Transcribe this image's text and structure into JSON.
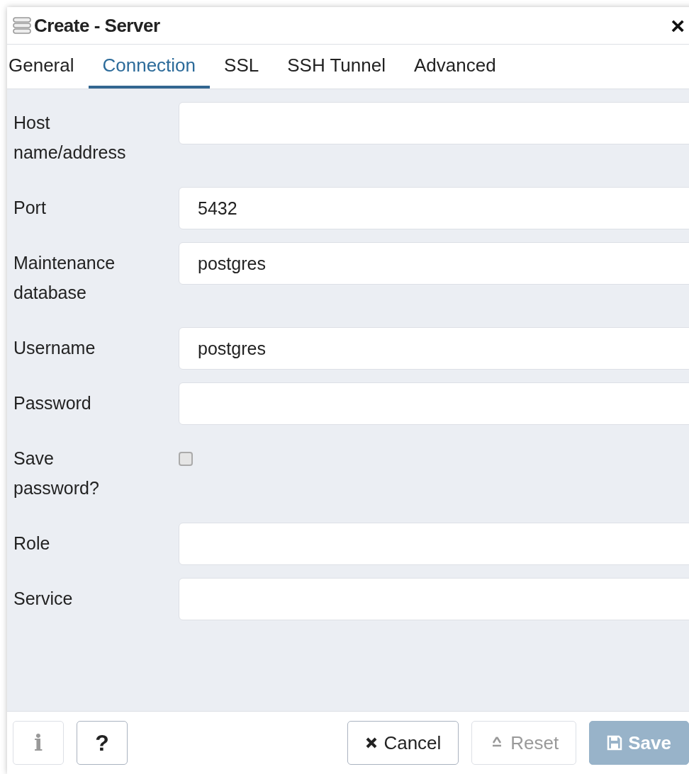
{
  "window": {
    "title": "Create - Server",
    "close": "×"
  },
  "tabs": [
    {
      "label": "General",
      "selected": false
    },
    {
      "label": "Connection",
      "selected": true
    },
    {
      "label": "SSL",
      "selected": false
    },
    {
      "label": "SSH Tunnel",
      "selected": false
    },
    {
      "label": "Advanced",
      "selected": false
    }
  ],
  "fields": [
    {
      "kind": "text",
      "label": "Host name/address"
    },
    {
      "kind": "text",
      "label": "Port",
      "value": "5432"
    },
    {
      "kind": "text",
      "label": "Maintenance database",
      "value": "postgres"
    },
    {
      "kind": "text",
      "label": "Username",
      "value": "postgres"
    },
    {
      "kind": "password",
      "label": "Password"
    },
    {
      "kind": "checkbox",
      "label": "Save password?",
      "checked": false
    },
    {
      "kind": "text",
      "label": "Role"
    },
    {
      "kind": "text",
      "label": "Service"
    }
  ],
  "footer": {
    "left_buttons": [
      {
        "kind": "info",
        "label": "i",
        "disabled": true
      },
      {
        "kind": "help",
        "label": "?",
        "disabled": false
      }
    ],
    "right_buttons": [
      {
        "kind": "cancel",
        "label": "Cancel",
        "disabled": false,
        "primary": false
      },
      {
        "kind": "reset",
        "label": "Reset",
        "disabled": true,
        "primary": false
      },
      {
        "kind": "save",
        "label": "Save",
        "disabled": true,
        "primary": true
      }
    ]
  }
}
